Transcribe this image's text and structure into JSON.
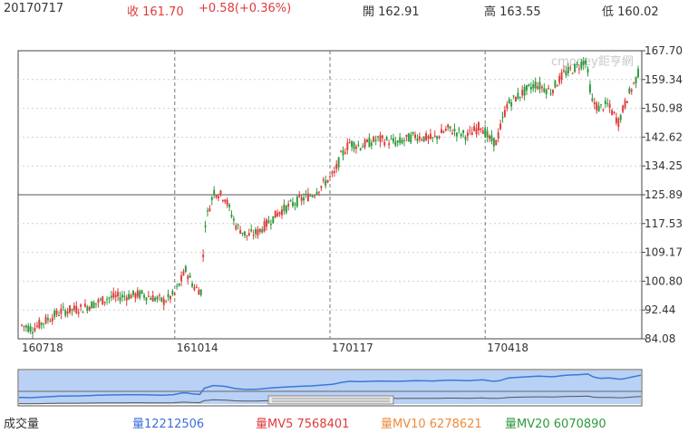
{
  "header": {
    "date": "20170717",
    "close_label": "收 161.70",
    "change_label": "+0.58(+0.36%)",
    "open_label": "開 162.91",
    "high_label": "高 163.55",
    "low_label": "低 160.02"
  },
  "watermark": "cmoney鉅亨網",
  "footer": {
    "volume_title": "成交量",
    "volume": "量12212506",
    "mv5": "量MV5 7568401",
    "mv10": "量MV10 6278621",
    "mv20": "量MV20 6070890"
  },
  "colors": {
    "up": "#e03a3a",
    "down": "#2c9a3a",
    "grid": "#cfcfcf",
    "navigator_fill": "#b9d1f5",
    "navigator_line": "#3a78d8"
  },
  "chart_data": {
    "type": "candlestick",
    "y_ticks": [
      "167.70",
      "159.34",
      "150.98",
      "142.62",
      "134.25",
      "125.89",
      "117.53",
      "109.17",
      "100.80",
      "92.44",
      "84.08"
    ],
    "x_ticks": [
      "160718",
      "161014",
      "170117",
      "170418"
    ],
    "ylim": [
      84.08,
      167.7
    ],
    "reference_line": 125.89,
    "grid": true,
    "close_path": [
      [
        0,
        88
      ],
      [
        5,
        87
      ],
      [
        10,
        89
      ],
      [
        18,
        92
      ],
      [
        28,
        93
      ],
      [
        40,
        96
      ],
      [
        55,
        97
      ],
      [
        65,
        95
      ],
      [
        70,
        97
      ],
      [
        75,
        104
      ],
      [
        79,
        99
      ],
      [
        82,
        98
      ],
      [
        84,
        118
      ],
      [
        88,
        127
      ],
      [
        93,
        125
      ],
      [
        98,
        117
      ],
      [
        103,
        114
      ],
      [
        108,
        115
      ],
      [
        113,
        118
      ],
      [
        118,
        121
      ],
      [
        126,
        124
      ],
      [
        133,
        126
      ],
      [
        138,
        129
      ],
      [
        143,
        132
      ],
      [
        146,
        137
      ],
      [
        150,
        141
      ],
      [
        155,
        140
      ],
      [
        163,
        142
      ],
      [
        172,
        141
      ],
      [
        180,
        143
      ],
      [
        188,
        142
      ],
      [
        195,
        145
      ],
      [
        204,
        143
      ],
      [
        210,
        146
      ],
      [
        214,
        142
      ],
      [
        217,
        141
      ],
      [
        222,
        152
      ],
      [
        228,
        155
      ],
      [
        235,
        158
      ],
      [
        242,
        156
      ],
      [
        248,
        161
      ],
      [
        254,
        163
      ],
      [
        258,
        165
      ],
      [
        261,
        153
      ],
      [
        264,
        151
      ],
      [
        268,
        152
      ],
      [
        271,
        149
      ],
      [
        273,
        147
      ],
      [
        277,
        154
      ],
      [
        280,
        158
      ],
      [
        282,
        161
      ]
    ]
  }
}
